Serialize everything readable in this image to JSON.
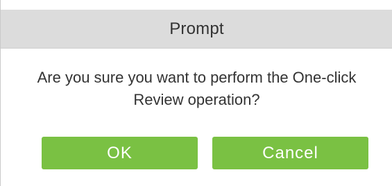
{
  "dialog": {
    "title": "Prompt",
    "message": "Are you sure you want to perform the One-click Review operation?",
    "ok_label": "OK",
    "cancel_label": "Cancel"
  },
  "colors": {
    "header_background": "#dcdcdc",
    "button_background": "#7ac143",
    "button_text": "#ffffff",
    "text": "#333333"
  }
}
